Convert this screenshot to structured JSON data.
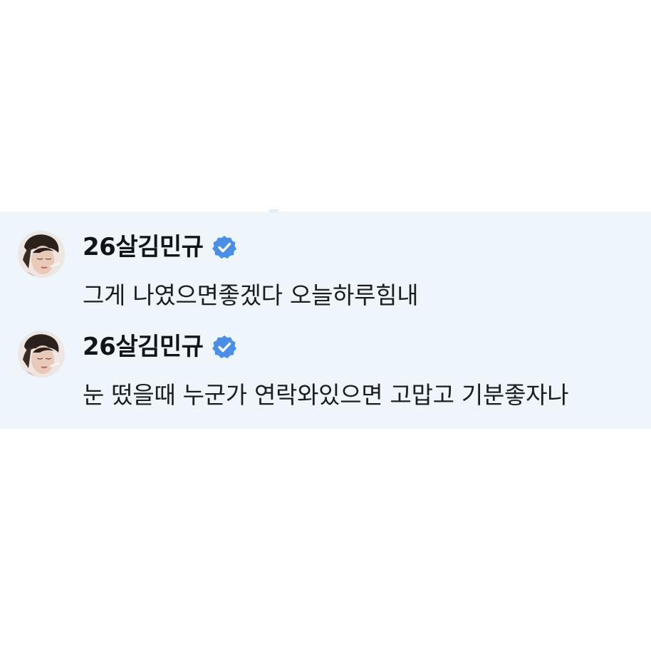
{
  "thread": {
    "messages": [
      {
        "author": "26살김민규",
        "verified": true,
        "avatar_icon": "profile-photo",
        "text": "그게 나였으면좋겠다 오늘하루힘내"
      },
      {
        "author": "26살김민규",
        "verified": true,
        "avatar_icon": "profile-photo",
        "text": "눈 떴을때 누군가 연락와있으면 고맙고 기분좋자나"
      }
    ]
  },
  "colors": {
    "thread_background": "#eef6fc",
    "verified_badge": "#4a8fe7",
    "name_text": "#111418",
    "body_text": "#1a1d21"
  }
}
